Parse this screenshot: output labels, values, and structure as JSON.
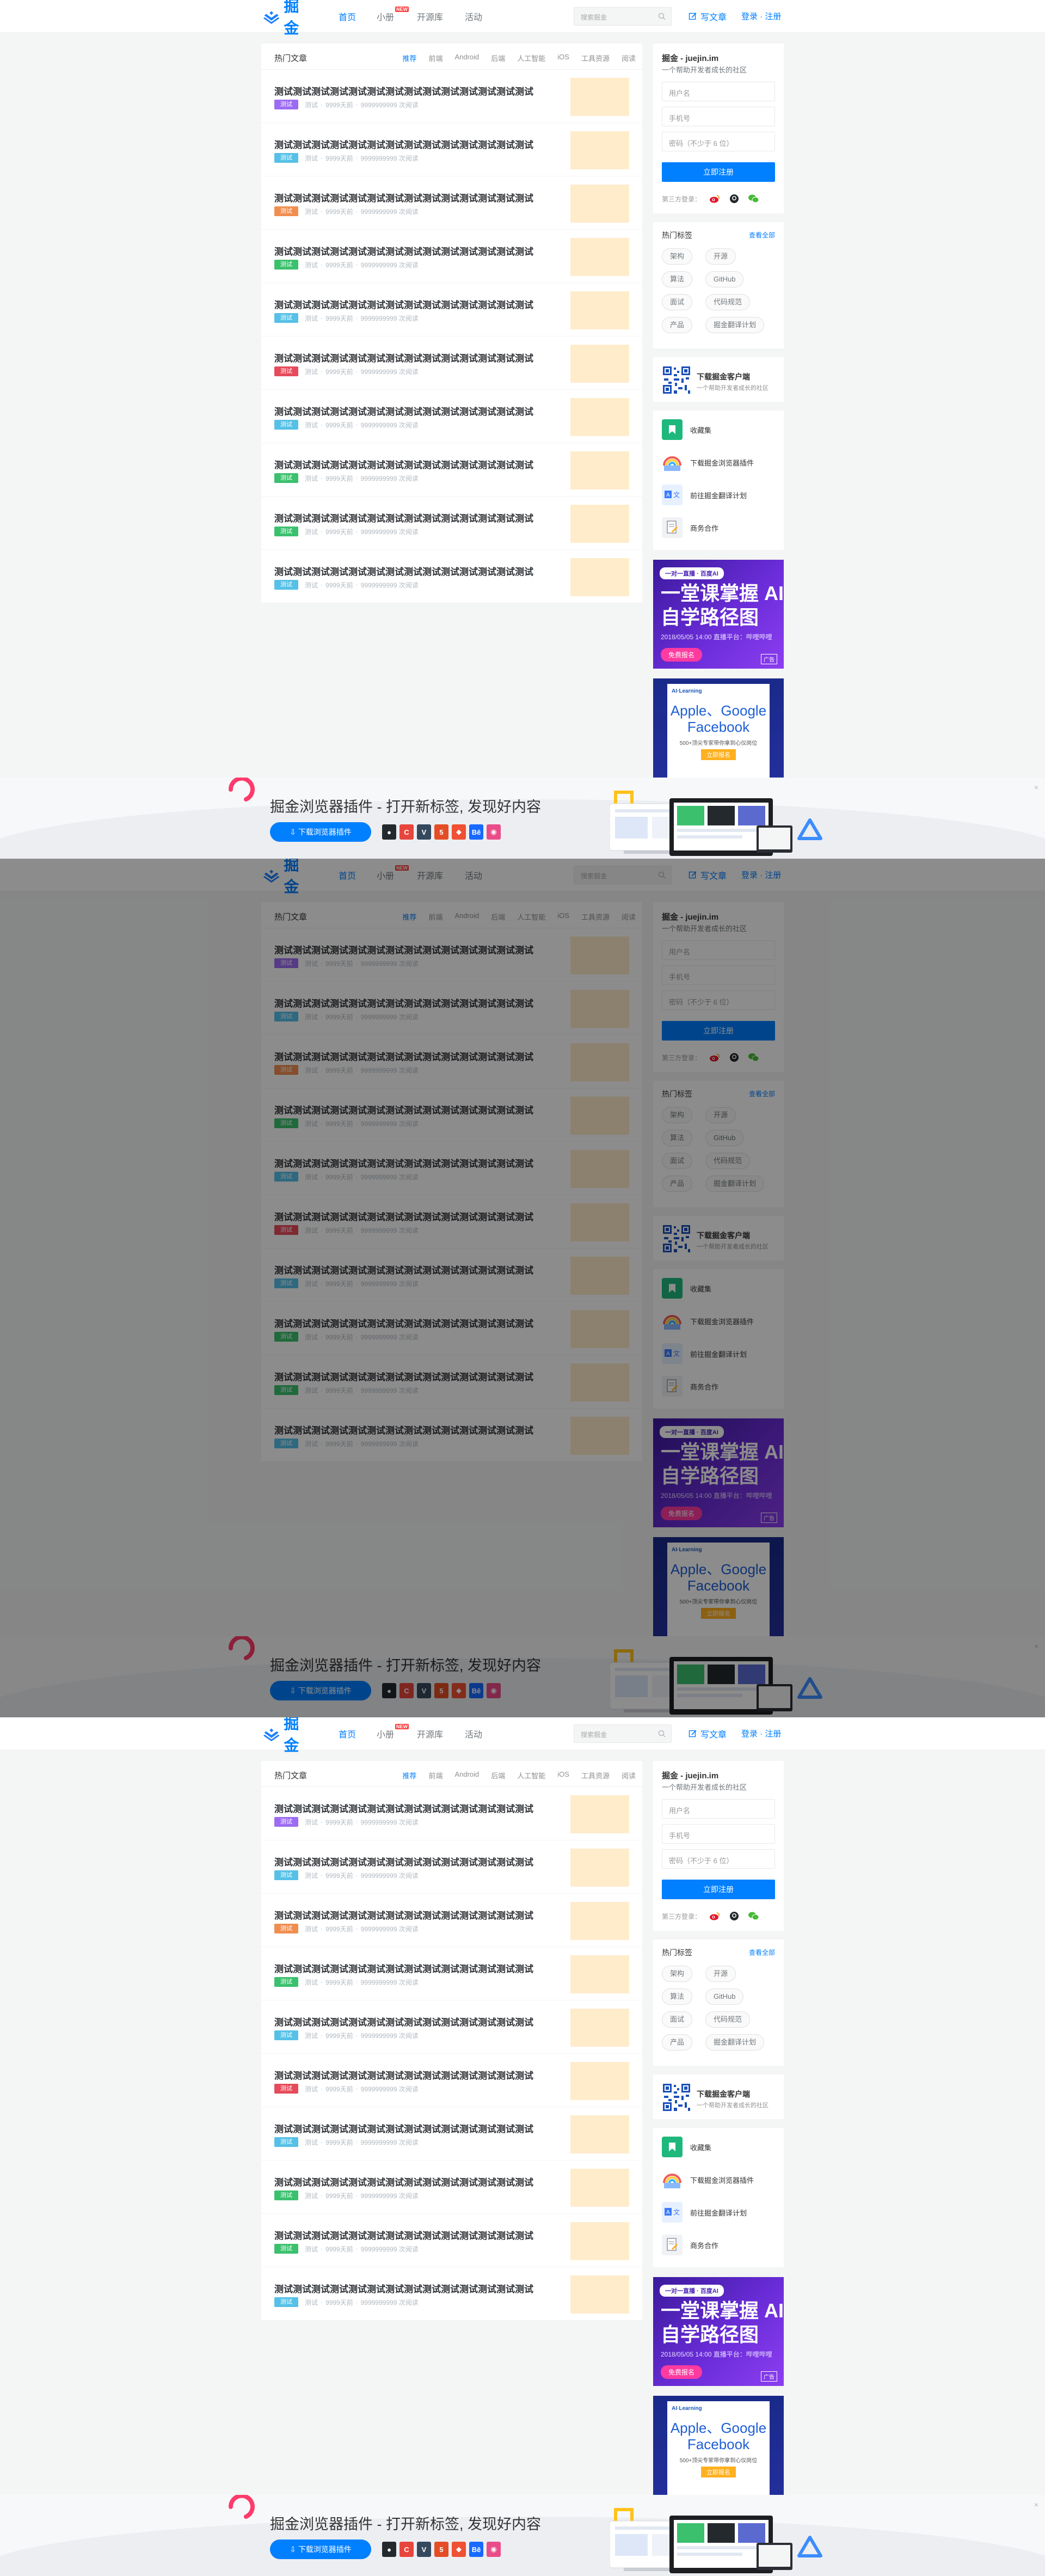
{
  "header": {
    "logo_text": "掘金",
    "nav": [
      {
        "label": "首页",
        "active": true
      },
      {
        "label": "小册",
        "badge": "NEW"
      },
      {
        "label": "开源库"
      },
      {
        "label": "活动"
      }
    ],
    "search_placeholder": "搜索掘金",
    "write_label": "写文章",
    "login_label": "登录 · 注册"
  },
  "main": {
    "title": "热门文章",
    "tabs": [
      "推荐",
      "前端",
      "Android",
      "后端",
      "人工智能",
      "iOS",
      "工具资源",
      "阅读"
    ],
    "articles": [
      {
        "title": "测试测试测试测试测试测试测试测试测试测试测试测试测试测试",
        "tag": "测试",
        "tag_color": "#9b6cf1",
        "meta": [
          "测试",
          "9999天前",
          "9999999999 次阅读"
        ]
      },
      {
        "title": "测试测试测试测试测试测试测试测试测试测试测试测试测试测试",
        "tag": "测试",
        "tag_color": "#56c0e7",
        "meta": [
          "测试",
          "9999天前",
          "9999999999 次阅读"
        ]
      },
      {
        "title": "测试测试测试测试测试测试测试测试测试测试测试测试测试测试",
        "tag": "测试",
        "tag_color": "#f08e50",
        "meta": [
          "测试",
          "9999天前",
          "9999999999 次阅读"
        ]
      },
      {
        "title": "测试测试测试测试测试测试测试测试测试测试测试测试测试测试",
        "tag": "测试",
        "tag_color": "#3bc06e",
        "meta": [
          "测试",
          "9999天前",
          "9999999999 次阅读"
        ]
      },
      {
        "title": "测试测试测试测试测试测试测试测试测试测试测试测试测试测试",
        "tag": "测试",
        "tag_color": "#56c0e7",
        "meta": [
          "测试",
          "9999天前",
          "9999999999 次阅读"
        ]
      },
      {
        "title": "测试测试测试测试测试测试测试测试测试测试测试测试测试测试",
        "tag": "测试",
        "tag_color": "#e54b5b",
        "meta": [
          "测试",
          "9999天前",
          "9999999999 次阅读"
        ]
      },
      {
        "title": "测试测试测试测试测试测试测试测试测试测试测试测试测试测试",
        "tag": "测试",
        "tag_color": "#56c0e7",
        "meta": [
          "测试",
          "9999天前",
          "9999999999 次阅读"
        ]
      },
      {
        "title": "测试测试测试测试测试测试测试测试测试测试测试测试测试测试",
        "tag": "测试",
        "tag_color": "#3bc06e",
        "meta": [
          "测试",
          "9999天前",
          "9999999999 次阅读"
        ]
      },
      {
        "title": "测试测试测试测试测试测试测试测试测试测试测试测试测试测试",
        "tag": "测试",
        "tag_color": "#3bc06e",
        "meta": [
          "测试",
          "9999天前",
          "9999999999 次阅读"
        ]
      },
      {
        "title": "测试测试测试测试测试测试测试测试测试测试测试测试测试测试",
        "tag": "测试",
        "tag_color": "#56c0e7",
        "meta": [
          "测试",
          "9999天前",
          "9999999999 次阅读"
        ]
      }
    ]
  },
  "sidebar": {
    "register": {
      "title": "掘金 - juejin.im",
      "subtitle": "一个帮助开发者成长的社区",
      "username_placeholder": "用户名",
      "phone_placeholder": "手机号",
      "password_placeholder": "密码（不少于 6 位）",
      "submit_label": "立即注册",
      "oauth_label": "第三方登录："
    },
    "tags": {
      "title": "热门标签",
      "more_label": "查看全部",
      "items": [
        "架构",
        "开源",
        "算法",
        "GitHub",
        "面试",
        "代码规范",
        "产品",
        "掘金翻译计划"
      ]
    },
    "app": {
      "title": "下载掘金客户端",
      "subtitle": "一个帮助开发者成长的社区"
    },
    "links": [
      {
        "label": "收藏集",
        "icon": "bookmark-icon"
      },
      {
        "label": "下载掘金浏览器插件",
        "icon": "rainbow-icon"
      },
      {
        "label": "前往掘金翻译计划",
        "icon": "translate-icon"
      },
      {
        "label": "商务合作",
        "icon": "document-icon"
      }
    ],
    "ad1": {
      "chip": "一对一直播 · 百度AI",
      "headline": "一堂课掌握 AI 自学路径图",
      "detail": "2018/05/05 14:00 直播平台：哔哩哔哩",
      "button": "免费报名",
      "ad_tag": "广告"
    },
    "ad2": {
      "brand": "AI·Learning",
      "headline": "Apple、Google Facebook",
      "detail": "500+顶尖专家带你拿到心仪岗位",
      "button": "立即报名"
    }
  },
  "banner": {
    "title": "掘金浏览器插件 - 打开新标签, 发现好内容",
    "button": "下载浏览器插件",
    "close": "×",
    "browser_icons": [
      "github-icon",
      "chrome-icon",
      "vue-icon",
      "html5-icon",
      "git-icon",
      "behance-icon",
      "dribbble-icon"
    ]
  },
  "colors": {
    "accent": "#007fff",
    "background": "#f4f5f5",
    "thumb": "#ffeccb"
  }
}
